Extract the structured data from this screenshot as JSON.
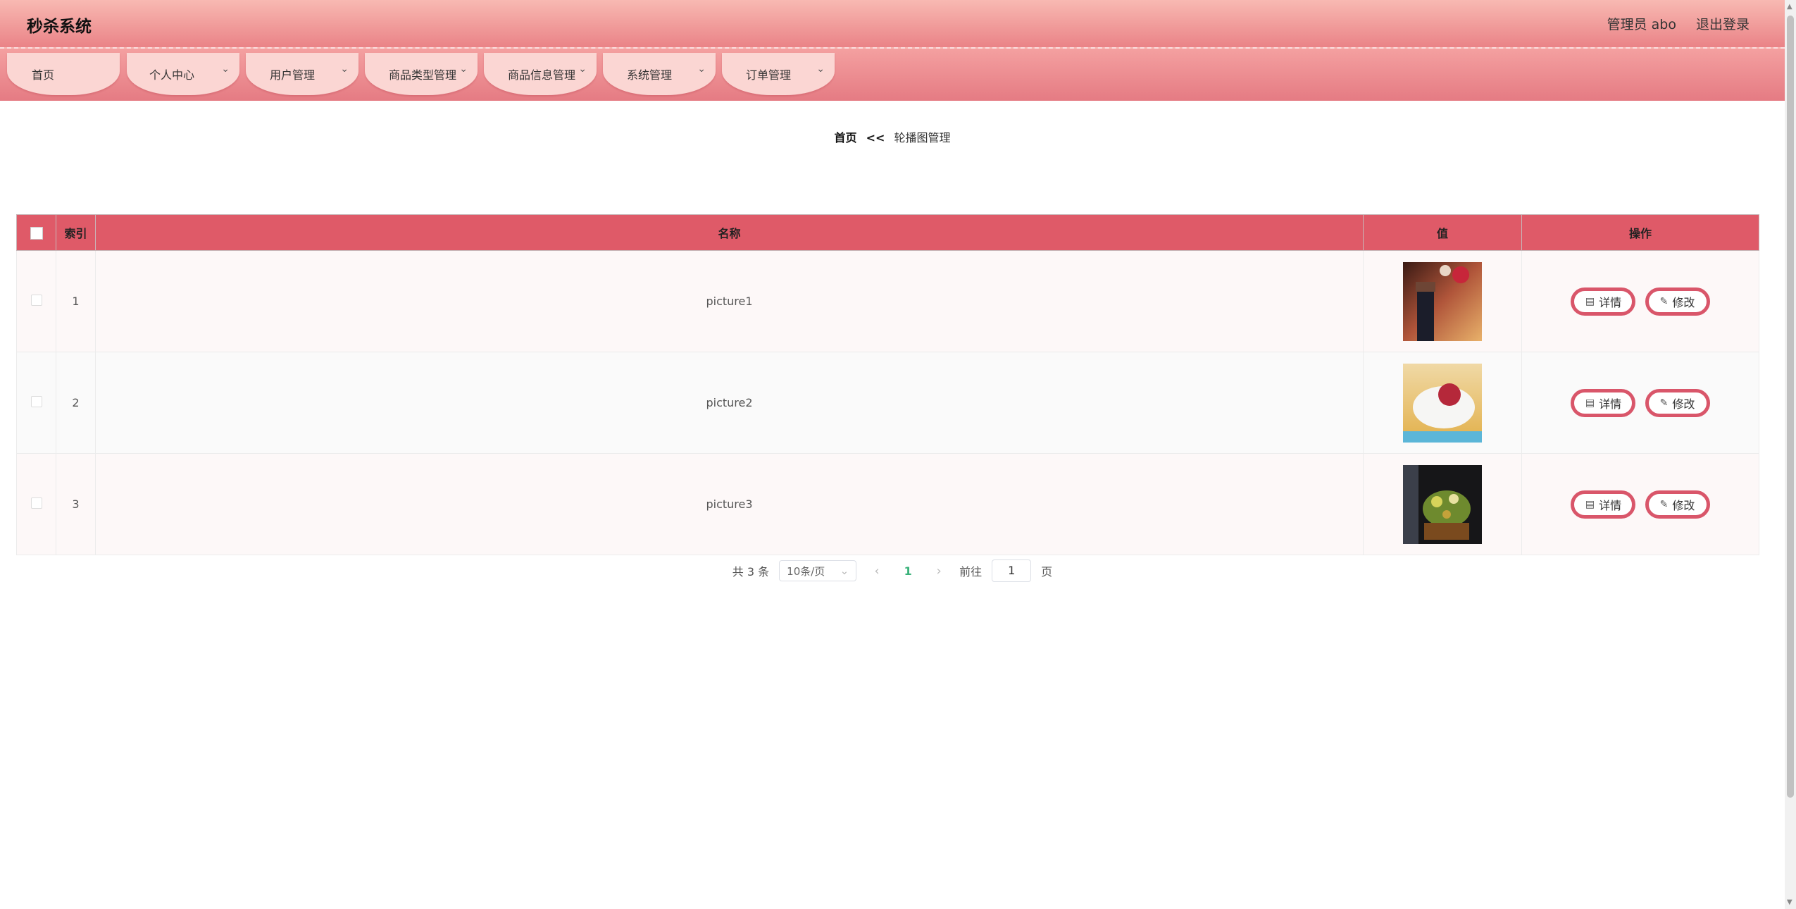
{
  "header": {
    "title": "秒杀系统",
    "user_label": "管理员 abo",
    "logout": "退出登录"
  },
  "nav": [
    {
      "label": "首页",
      "has_chevron": false
    },
    {
      "label": "个人中心",
      "has_chevron": true
    },
    {
      "label": "用户管理",
      "has_chevron": true
    },
    {
      "label": "商品类型管理",
      "has_chevron": true
    },
    {
      "label": "商品信息管理",
      "has_chevron": true
    },
    {
      "label": "系统管理",
      "has_chevron": true
    },
    {
      "label": "订单管理",
      "has_chevron": true
    }
  ],
  "breadcrumb": {
    "home": "首页",
    "separator": "<<",
    "current": "轮播图管理"
  },
  "table": {
    "columns": [
      "索引",
      "名称",
      "值",
      "操作"
    ],
    "rows": [
      {
        "index": "1",
        "name": "picture1",
        "thumb": "thumb-1"
      },
      {
        "index": "2",
        "name": "picture2",
        "thumb": "thumb-2"
      },
      {
        "index": "3",
        "name": "picture3",
        "thumb": "thumb-3"
      }
    ],
    "detail_label": "详情",
    "edit_label": "修改"
  },
  "pagination": {
    "total_text": "共 3 条",
    "page_size": "10条/页",
    "current_page": "1",
    "goto_label": "前往",
    "goto_value": "1",
    "page_suffix": "页"
  },
  "colors": {
    "header_top": "#f8b9b2",
    "header_bottom": "#ea8387",
    "table_header": "#df5a68",
    "button_border": "#d9566a",
    "active_page": "#3ab27a"
  }
}
